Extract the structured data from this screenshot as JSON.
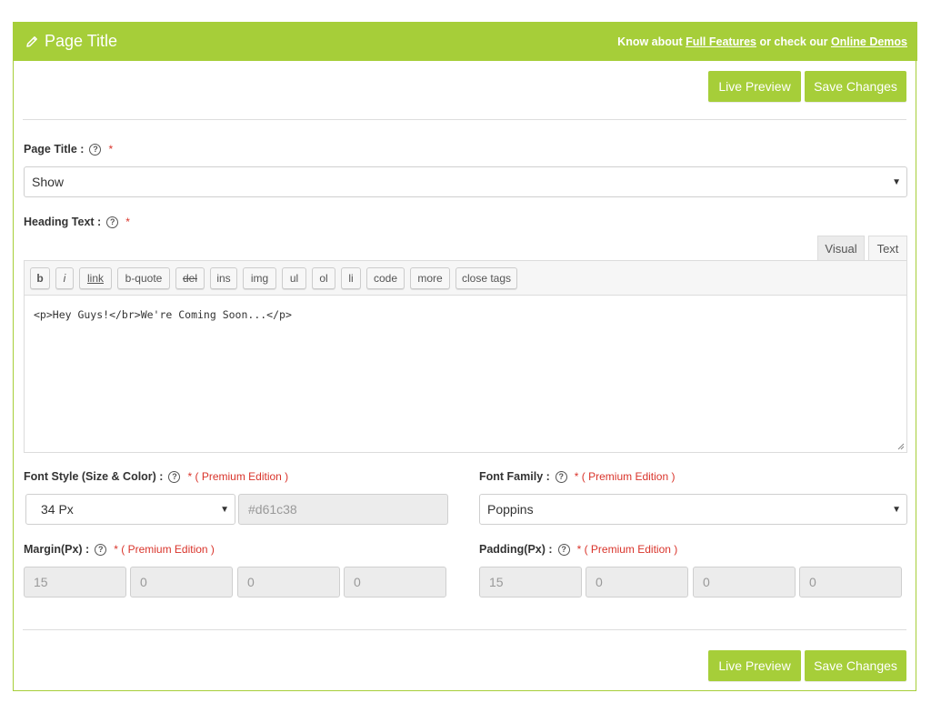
{
  "header": {
    "title": "Page Title",
    "links_prefix": "Know about ",
    "link_full_features": "Full Features",
    "links_middle": " or check our ",
    "link_online_demos": "Online Demos"
  },
  "buttons": {
    "live_preview": "Live Preview",
    "save_changes": "Save Changes"
  },
  "page_title_field": {
    "label": "Page Title :",
    "required": "*",
    "value": "Show"
  },
  "heading_text_field": {
    "label": "Heading Text :",
    "required": "*",
    "tabs": [
      "Visual",
      "Text"
    ],
    "quicktags": [
      "b",
      "i",
      "link",
      "b-quote",
      "del",
      "ins",
      "img",
      "ul",
      "ol",
      "li",
      "code",
      "more",
      "close tags"
    ],
    "content": "<p>Hey Guys!</br>We're Coming Soon...</p>"
  },
  "font_style_field": {
    "label": "Font Style (Size & Color) :",
    "premium": "* ( Premium Edition )",
    "size_value": "34 Px",
    "color_value": "#d61c38"
  },
  "font_family_field": {
    "label": "Font Family :",
    "premium": "* ( Premium Edition )",
    "value": "Poppins"
  },
  "margin_field": {
    "label": "Margin(Px) :",
    "premium": "* ( Premium Edition )",
    "values": [
      "15",
      "0",
      "0",
      "0"
    ]
  },
  "padding_field": {
    "label": "Padding(Px) :",
    "premium": "* ( Premium Edition )",
    "values": [
      "15",
      "0",
      "0",
      "0"
    ]
  },
  "colors": {
    "accent": "#a6ce39",
    "required": "#d9342b"
  }
}
